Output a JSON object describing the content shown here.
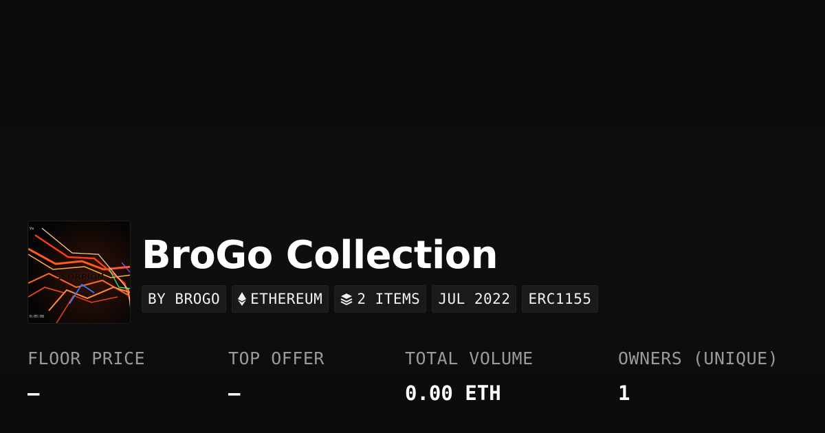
{
  "collection": {
    "title": "BroGo Collection",
    "thumbnail": {
      "overlay_text": "SCORPION",
      "corner_text": "Va",
      "timestamp": "0:05:08"
    }
  },
  "tags": [
    {
      "label": "BY BROGO",
      "icon": null
    },
    {
      "label": "ETHEREUM",
      "icon": "ethereum-icon"
    },
    {
      "label": "2 ITEMS",
      "icon": "layers-icon"
    },
    {
      "label": "JUL 2022",
      "icon": null
    },
    {
      "label": "ERC1155",
      "icon": null
    }
  ],
  "stats": [
    {
      "label": "FLOOR PRICE",
      "value": "–"
    },
    {
      "label": "TOP OFFER",
      "value": "–"
    },
    {
      "label": "TOTAL VOLUME",
      "value": "0.00 ETH"
    },
    {
      "label": "OWNERS (UNIQUE)",
      "value": "1"
    }
  ],
  "colors": {
    "background": "#0c0c0c",
    "tag_background": "#1a1a1a",
    "label_gray": "#9a9a9a",
    "text_white": "#ffffff"
  }
}
